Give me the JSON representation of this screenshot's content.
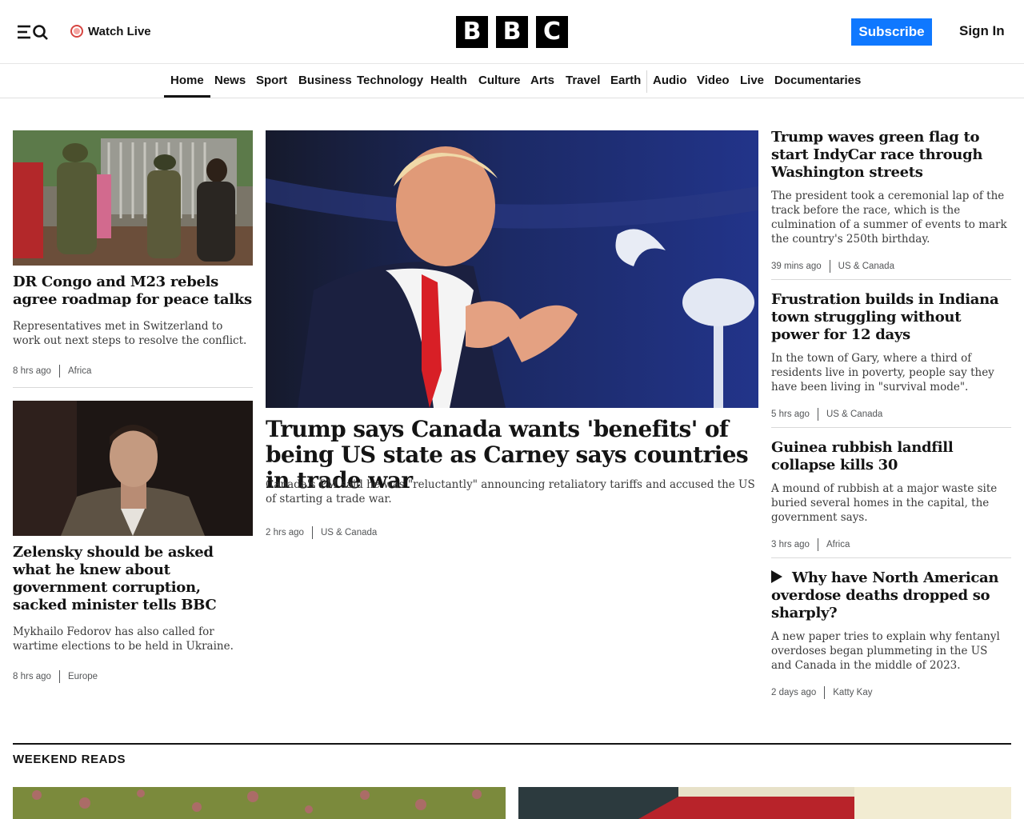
{
  "header": {
    "watch_live": "Watch Live",
    "logo_letters": [
      "B",
      "B",
      "C"
    ],
    "subscribe": "Subscribe",
    "sign_in": "Sign In"
  },
  "nav": {
    "items": [
      "Home",
      "News",
      "Sport",
      "Business",
      "Technology",
      "Health",
      "Culture",
      "Arts",
      "Travel",
      "Earth",
      "Audio",
      "Video",
      "Live",
      "Documentaries"
    ],
    "active": "Home"
  },
  "stories": {
    "left": [
      {
        "headline": "DR Congo and M23 rebels agree roadmap for peace talks",
        "summary": "Representatives met in Switzerland to work out next steps to resolve the conflict.",
        "time": "8 hrs ago",
        "section": "Africa"
      },
      {
        "headline": "Zelensky should be asked what he knew about government corruption, sacked minister tells BBC",
        "summary": "Mykhailo Fedorov has also called for wartime elections to be held in Ukraine.",
        "time": "8 hrs ago",
        "section": "Europe"
      }
    ],
    "main": {
      "headline": "Trump says Canada wants 'benefits' of being US state as Carney says countries in trade war",
      "summary": "Canada's PM said he was \"reluctantly\" announcing retaliatory tariffs and accused the US of starting a trade war.",
      "time": "2 hrs ago",
      "section": "US & Canada"
    },
    "right": [
      {
        "headline": "Trump waves green flag to start IndyCar race through Washington streets",
        "summary": "The president took a ceremonial lap of the track before the race, which is the culmination of a summer of events to mark the country's 250th birthday.",
        "time": "39 mins ago",
        "section": "US & Canada"
      },
      {
        "headline": "Frustration builds in Indiana town struggling without power for 12 days",
        "summary": "In the town of Gary, where a third of residents live in poverty, people say they have been living in \"survival mode\".",
        "time": "5 hrs ago",
        "section": "US & Canada"
      },
      {
        "headline": "Guinea rubbish landfill collapse kills 30",
        "summary": "A mound of rubbish at a major waste site buried several homes in the capital, the government says.",
        "time": "3 hrs ago",
        "section": "Africa"
      },
      {
        "headline": "Why have North American overdose deaths dropped so sharply?",
        "summary": "A new paper tries to explain why fentanyl overdoses began plummeting in the US and Canada in the middle of 2023.",
        "time": "2 days ago",
        "section": "Katty Kay",
        "icon": "play-icon"
      }
    ]
  },
  "weekend_reads": {
    "title": "WEEKEND READS"
  },
  "colors": {
    "accent": "#0f78ff",
    "live_red": "#d64541",
    "text": "#141414"
  }
}
